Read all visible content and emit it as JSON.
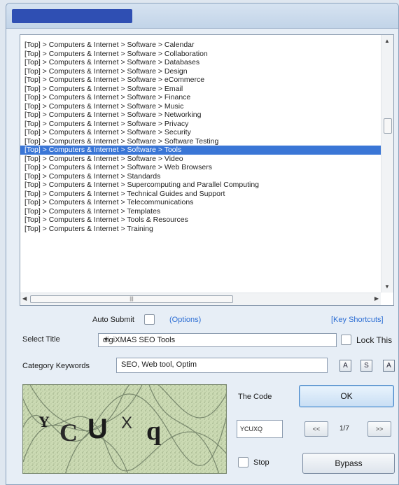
{
  "category_list": {
    "items": [
      "[Top] > Computers & Internet > Software > Calendar",
      "[Top] > Computers & Internet > Software > Collaboration",
      "[Top] > Computers & Internet > Software > Databases",
      "[Top] > Computers & Internet > Software > Design",
      "[Top] > Computers & Internet > Software > eCommerce",
      "[Top] > Computers & Internet > Software > Email",
      "[Top] > Computers & Internet > Software > Finance",
      "[Top] > Computers & Internet > Software > Music",
      "[Top] > Computers & Internet > Software > Networking",
      "[Top] > Computers & Internet > Software > Privacy",
      "[Top] > Computers & Internet > Software > Security",
      "[Top] > Computers & Internet > Software > Software Testing",
      "[Top] > Computers & Internet > Software > Tools",
      "[Top] > Computers & Internet > Software > Video",
      "[Top] > Computers & Internet > Software > Web Browsers",
      "[Top] > Computers & Internet > Standards",
      "[Top] > Computers & Internet > Supercomputing and Parallel Computing",
      "[Top] > Computers & Internet > Technical Guides and Support",
      "[Top] > Computers & Internet > Telecommunications",
      "[Top] > Computers & Internet > Templates",
      "[Top] > Computers & Internet > Tools & Resources",
      "[Top] > Computers & Internet > Training"
    ],
    "selected_index": 12
  },
  "auto_submit": {
    "label": "Auto Submit",
    "checked": false
  },
  "options_link": "(Options)",
  "key_shortcuts_link": "[Key Shortcuts]",
  "select_title": {
    "label": "Select Title",
    "value": "digiXMAS SEO Tools"
  },
  "lock_this": {
    "label": "Lock This",
    "checked": false
  },
  "category_keywords": {
    "label": "Category Keywords",
    "value": "SEO, Web tool, Optim"
  },
  "case_buttons": [
    "A",
    "S",
    "A"
  ],
  "captcha": {
    "text": "YCUXq"
  },
  "the_code": {
    "label": "The Code",
    "value": "YCUXQ"
  },
  "ok_label": "OK",
  "nav": {
    "prev": "<<",
    "next": ">>",
    "counter": "1/7"
  },
  "stop": {
    "label": "Stop",
    "checked": false
  },
  "bypass_label": "Bypass",
  "colors": {
    "selection": "#3a76d6",
    "link": "#2d6ed4",
    "title_fill": "#2f4fb3"
  }
}
